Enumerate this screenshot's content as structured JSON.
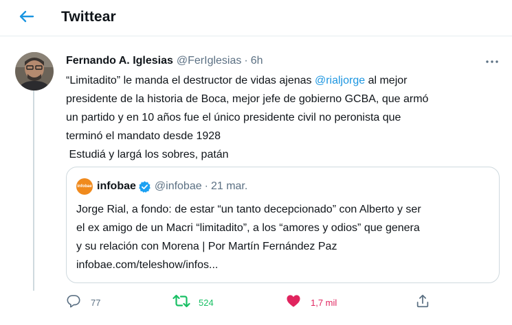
{
  "header": {
    "title": "Twittear"
  },
  "tweet": {
    "author_name": "Fernando A. Iglesias",
    "author_handle": "@FerIglesias",
    "separator": "·",
    "time": "6h",
    "text": {
      "line1_pre": "“Limitadito” le manda el destructor de vidas ajenas ",
      "line1_mention": "@rialjorge",
      "line1_post": " al mejor",
      "line2": "presidente de la historia de Boca, mejor jefe de gobierno GCBA, que armó",
      "line3": "un partido y en 10 años fue el único presidente civil no peronista que",
      "line4": "terminó el mandato desde 1928",
      "line5": " Estudiá y largá los sobres, patán"
    }
  },
  "quote": {
    "avatar_text": "infobae",
    "name": "infobae",
    "handle": "@infobae",
    "separator": "·",
    "date": "21 mar.",
    "lines": [
      "Jorge Rial, a fondo: de estar “un tanto decepcionado” con Alberto y ser",
      "el ex amigo de un Macri “limitadito”, a los “amores y odios” que genera",
      "y su relación con Morena | Por Martín Fernández Paz",
      "infobae.com/teleshow/infos..."
    ]
  },
  "actions": {
    "replies": "77",
    "retweets": "524",
    "likes": "1,7 mil"
  },
  "colors": {
    "accent": "#1b95e0",
    "retweet": "#17bf63",
    "like": "#e0245e",
    "muted": "#5b7083",
    "border": "#cfd9de"
  },
  "icons": {
    "back": "arrow-left-icon",
    "more": "more-dots-icon",
    "verified": "verified-badge-icon",
    "reply": "reply-bubble-icon",
    "retweet": "retweet-icon",
    "like": "heart-filled-icon",
    "share": "share-icon"
  }
}
